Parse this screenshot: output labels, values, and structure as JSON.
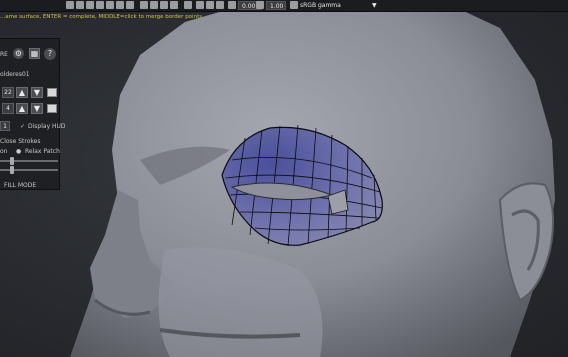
{
  "status_text": "...ame surface, ENTER = complete, MIDDLE=click to merge border points",
  "toolbar": {
    "field_a": "0.00",
    "field_b": "1.00",
    "colorspace": "sRGB gamma",
    "dropdown_arrow": "chevron-down-icon"
  },
  "panel": {
    "header_label": "RE",
    "object_name": "olderes01",
    "row1_value": "22",
    "row2_value": "4",
    "row3_value": "1",
    "display_hud_label": "Display HUD",
    "close_strokes_label": "Close Strokes",
    "relax_patch_label": "Relax Patch",
    "relax_prefix": "on",
    "mode_label": "FILL MODE"
  },
  "colors": {
    "skin": "#8e909b",
    "mesh_fill": "#5d60a8",
    "status_yellow": "#c8c840"
  }
}
